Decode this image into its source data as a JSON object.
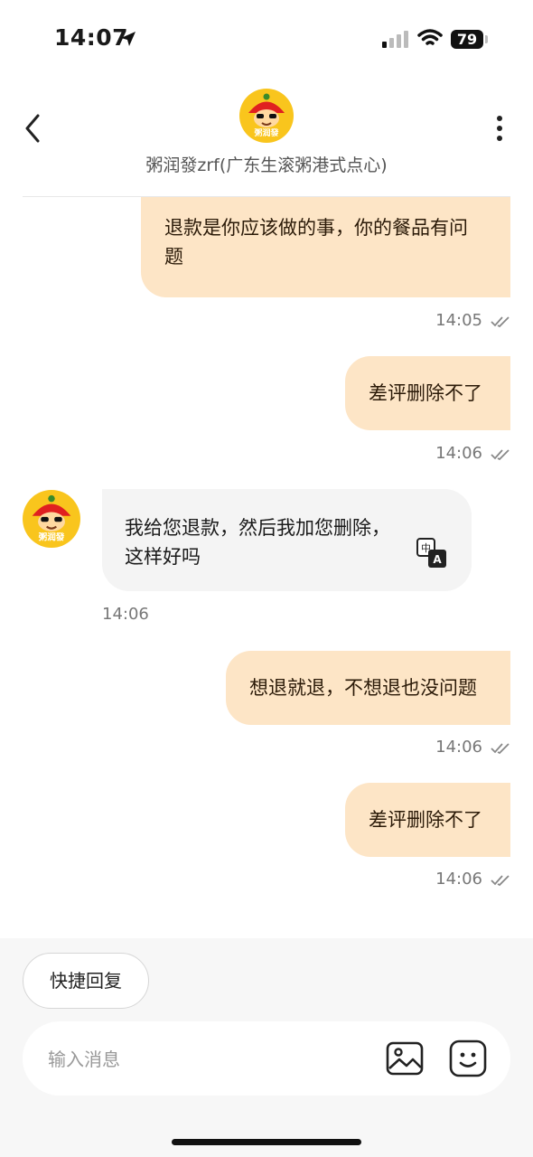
{
  "status_bar": {
    "time": "14:07",
    "battery": "79"
  },
  "header": {
    "shop_name": "粥润發zrf(广东生滚粥港式点心)",
    "avatar_text": "粥润發"
  },
  "messages": [
    {
      "dir": "out",
      "lines": [
        "退款是你应该做的事，你的餐品有问",
        "题"
      ],
      "time": "14:05"
    },
    {
      "dir": "out",
      "lines": [
        "差评删除不了"
      ],
      "time": "14:06"
    },
    {
      "dir": "in",
      "lines": [
        "我给您退款，然后我加您删除，",
        "这样好吗"
      ],
      "time": "14:06",
      "translate_glyph": "中",
      "translate_glyph_b": "A"
    },
    {
      "dir": "out",
      "lines": [
        "想退就退，不想退也没问题"
      ],
      "time": "14:06"
    },
    {
      "dir": "out",
      "lines": [
        "差评删除不了"
      ],
      "time": "14:06"
    }
  ],
  "bottom": {
    "quick_reply_label": "快捷回复",
    "input_placeholder": "输入消息"
  },
  "colors": {
    "outgoing_bubble": "#fde5c6",
    "incoming_bubble": "#f4f4f4",
    "avatar_bg": "#f9c51d",
    "hat": "#e02020"
  },
  "icons": [
    "location-arrow-icon",
    "signal-icon",
    "wifi-icon",
    "back-chevron-icon",
    "more-dots-icon",
    "double-check-icon",
    "translate-icon",
    "image-icon",
    "emoji-icon"
  ]
}
